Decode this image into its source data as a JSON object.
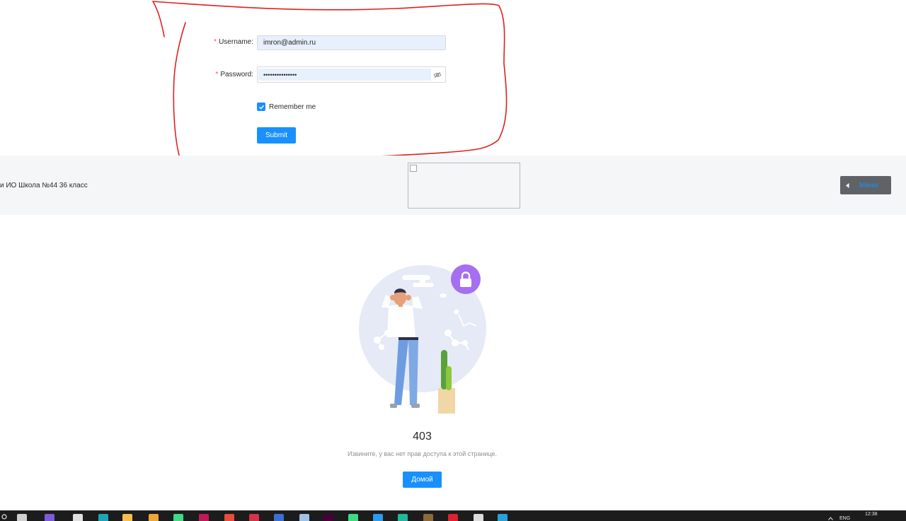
{
  "login": {
    "username_label": "Username",
    "username_value": "imron@admin.ru",
    "password_label": "Password",
    "password_value": "•••••••••••••••",
    "remember_label": "Remember me",
    "remember_checked": true,
    "submit_label": "Submit",
    "colon": ":"
  },
  "header": {
    "school_text": "и ИО Школа №44 36 класс",
    "menu_label": "Меню"
  },
  "error": {
    "code": "403",
    "message": "Извините, у вас нет прав доступа к этой странице.",
    "home_label": "Домой"
  },
  "taskbar": {
    "lang": "ENG",
    "time": "12:38",
    "icons": [
      {
        "name": "task-view-icon",
        "color": "#d0d0d0"
      },
      {
        "name": "app-purple-icon",
        "color": "#7c5cd6"
      },
      {
        "name": "printer-icon",
        "color": "#e0e0e0"
      },
      {
        "name": "edge-icon",
        "color": "#1fa3b8"
      },
      {
        "name": "folder-icon",
        "color": "#f2c14b"
      },
      {
        "name": "paint-icon",
        "color": "#f0a43a"
      },
      {
        "name": "android-studio-icon",
        "color": "#3ddc84"
      },
      {
        "name": "intellij-icon",
        "color": "#c2185b"
      },
      {
        "name": "app-red-icon",
        "color": "#e94b3c"
      },
      {
        "name": "app-crimson-icon",
        "color": "#d6334a"
      },
      {
        "name": "save-icon",
        "color": "#3b6fd6"
      },
      {
        "name": "notepad-icon",
        "color": "#9ec1e6"
      },
      {
        "name": "xd-icon",
        "color": "#470137"
      },
      {
        "name": "android-icon",
        "color": "#3ddc84"
      },
      {
        "name": "vscode-icon",
        "color": "#2a9bf0"
      },
      {
        "name": "app-teal-icon",
        "color": "#20b89a"
      },
      {
        "name": "app-brown-icon",
        "color": "#8a6a3a"
      },
      {
        "name": "opera-icon",
        "color": "#e0202e"
      },
      {
        "name": "chrome-icon",
        "color": "#dcdcdc"
      },
      {
        "name": "telegram-icon",
        "color": "#2aa0da"
      }
    ]
  },
  "colors": {
    "primary": "#1890ff",
    "required": "#ff4d4f",
    "autofill": "#e8f0fe",
    "annotation": "#e02020"
  }
}
